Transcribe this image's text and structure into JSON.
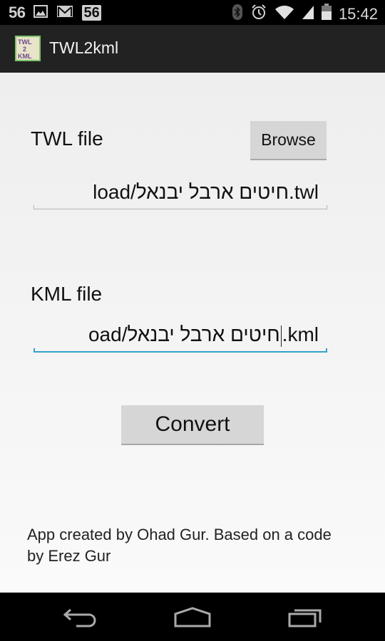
{
  "status_bar": {
    "left_number": "56",
    "left_icons": [
      "image-icon",
      "gmail-icon"
    ],
    "badge_number": "56",
    "right_icons": [
      "bluetooth-icon",
      "alarm-icon",
      "wifi-icon",
      "signal-icon",
      "battery-icon"
    ],
    "time": "15:42"
  },
  "action_bar": {
    "app_icon_text": [
      "TWL",
      "2",
      "KML"
    ],
    "title": "TWL2kml"
  },
  "main": {
    "twl_label": "TWL file",
    "browse_button": "Browse",
    "twl_field_value": "load/חיטים ארבל יבנאל.twl",
    "kml_label": "KML file",
    "kml_field_value_before_caret": "oad/חיטים ארבל יבנאל",
    "kml_field_value_after_caret": ".kml",
    "convert_button": "Convert",
    "footer_text": "App created by Ohad Gur. Based on a code by Erez Gur"
  },
  "nav_bar": {
    "buttons": [
      "back",
      "home",
      "recent-apps"
    ]
  },
  "colors": {
    "focus_accent": "#33a3cc",
    "action_bar_bg": "#222222",
    "button_bg": "#d6d6d6"
  }
}
